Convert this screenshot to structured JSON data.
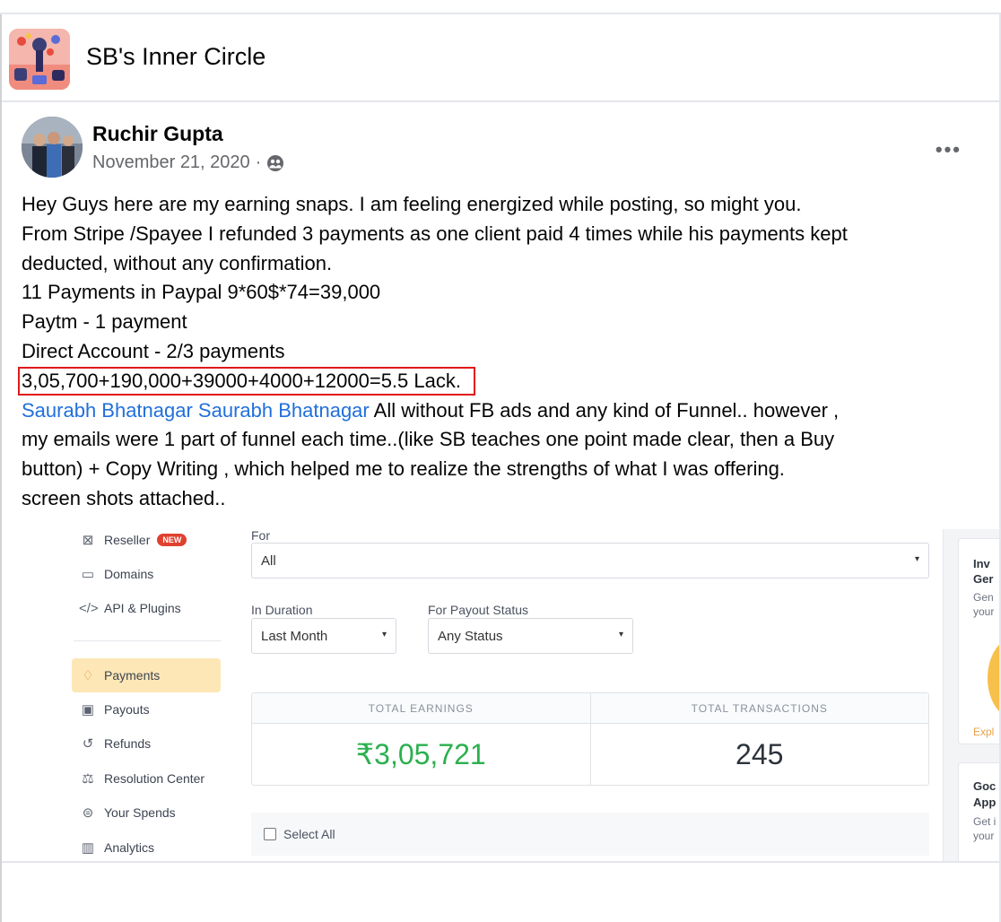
{
  "group": {
    "name": "SB's Inner Circle"
  },
  "post": {
    "author": "Ruchir Gupta",
    "date": "November 21, 2020",
    "separator": "·",
    "more": "•••",
    "lines": [
      "Hey Guys here are my earning snaps. I am feeling energized while posting, so might you.",
      "From Stripe /Spayee I refunded 3 payments as one client paid 4 times while his payments kept",
      "deducted, without any confirmation.",
      "11 Payments in Paypal 9*60$*74=39,000",
      "Paytm - 1 payment",
      "Direct Account - 2/3 payments"
    ],
    "highlighted": "3,05,700+190,000+39000+4000+12000=5.5 Lack.",
    "mention": "Saurabh Bhatnagar Saurabh Bhatnagar",
    "after_mention": " All without FB ads and any kind of Funnel.. however ,",
    "tail_lines": [
      "my emails were 1 part of funnel each time..(like SB teaches one point made clear, then a Buy",
      "button) + Copy Writing , which helped me to realize the strengths of what I was offering.",
      "screen shots attached.."
    ]
  },
  "dashboard": {
    "sidebar": [
      {
        "label": "Reseller",
        "badge": "NEW"
      },
      {
        "label": "Domains"
      },
      {
        "label": "API & Plugins"
      },
      {
        "label": "Payments"
      },
      {
        "label": "Payouts"
      },
      {
        "label": "Refunds"
      },
      {
        "label": "Resolution Center"
      },
      {
        "label": "Your Spends"
      },
      {
        "label": "Analytics"
      }
    ],
    "for_label": "For",
    "for_value": "All",
    "duration_label": "In Duration",
    "duration_value": "Last Month",
    "payout_label": "For Payout Status",
    "payout_value": "Any Status",
    "caret": "▾",
    "total_earnings_label": "TOTAL EARNINGS",
    "total_earnings_value": "₹3,05,721",
    "total_transactions_label": "TOTAL TRANSACTIONS",
    "total_transactions_value": "245",
    "select_all": "Select All",
    "right_cards": [
      {
        "title1": "Inv",
        "title2": "Ger",
        "sub1": "Gen",
        "sub2": "your",
        "link": "Expl"
      },
      {
        "title1": "Goc",
        "title2": "App",
        "sub1": "Get i",
        "sub2": "your"
      }
    ]
  },
  "colors": {
    "mention": "#216fdb",
    "highlight_border": "#e01919",
    "earnings": "#2bb04e",
    "active_nav": "#fde7b6"
  }
}
